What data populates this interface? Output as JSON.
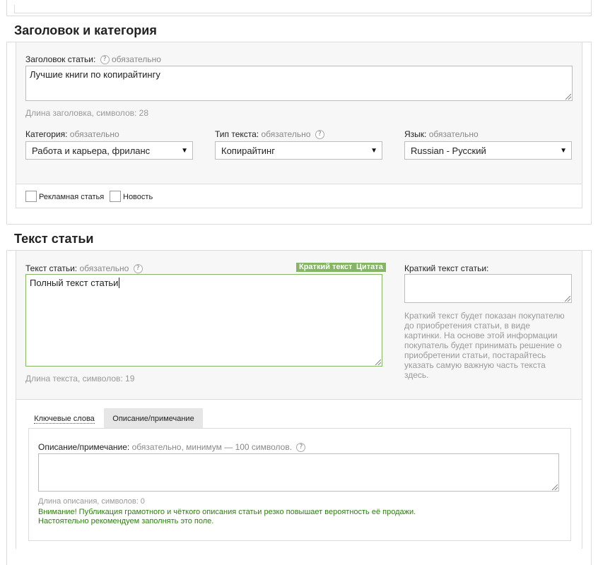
{
  "section1": {
    "title": "Заголовок и категория",
    "title_label": "Заголовок статьи:",
    "required": "обязательно",
    "title_value": "Лучшие книги по копирайтингу",
    "title_length": "Длина заголовка, символов: 28",
    "category": {
      "label": "Категория:",
      "required": "обязательно",
      "value": "Работа и карьера, фриланс"
    },
    "text_type": {
      "label": "Тип текста:",
      "required": "обязательно",
      "value": "Копирайтинг"
    },
    "language": {
      "label": "Язык:",
      "required": "обязательно",
      "value": "Russian - Русский"
    },
    "ad_label": "Рекламная статья",
    "news_label": "Новость"
  },
  "section2": {
    "title": "Текст статьи",
    "text_label": "Текст статьи:",
    "required": "обязательно",
    "tag_short": "Краткий текст",
    "tag_quote": "Цитата",
    "text_value": "Полный текст статьи",
    "text_length": "Длина текста, символов: 19",
    "short_label": "Краткий текст статьи:",
    "short_hint": [
      "Краткий текст будет показан покупателю",
      "до приобретения статьи, в виде",
      "картинки. На основе этой информации",
      "покупатель будет принимать решение о",
      "приобретении статьи, постарайтесь",
      "указать самую важную часть текста",
      "здесь."
    ]
  },
  "tabs": [
    "Ключевые слова",
    "Описание/примечание"
  ],
  "description": {
    "label": "Описание/примечание:",
    "required": "обязательно, минимум — 100 символов.",
    "length": "Длина описания, символов: 0",
    "warning1": "Внимание! Публикация грамотного и чёткого описания статьи резко повышает вероятность её продажи.",
    "warning2": "Настоятельно рекомендуем заполнять это поле."
  },
  "help_glyph": "?",
  "caret_glyph": "▼",
  "colors": {
    "green": "#86b565",
    "warning": "#2f7d14",
    "panel": "#f7f7f7"
  }
}
